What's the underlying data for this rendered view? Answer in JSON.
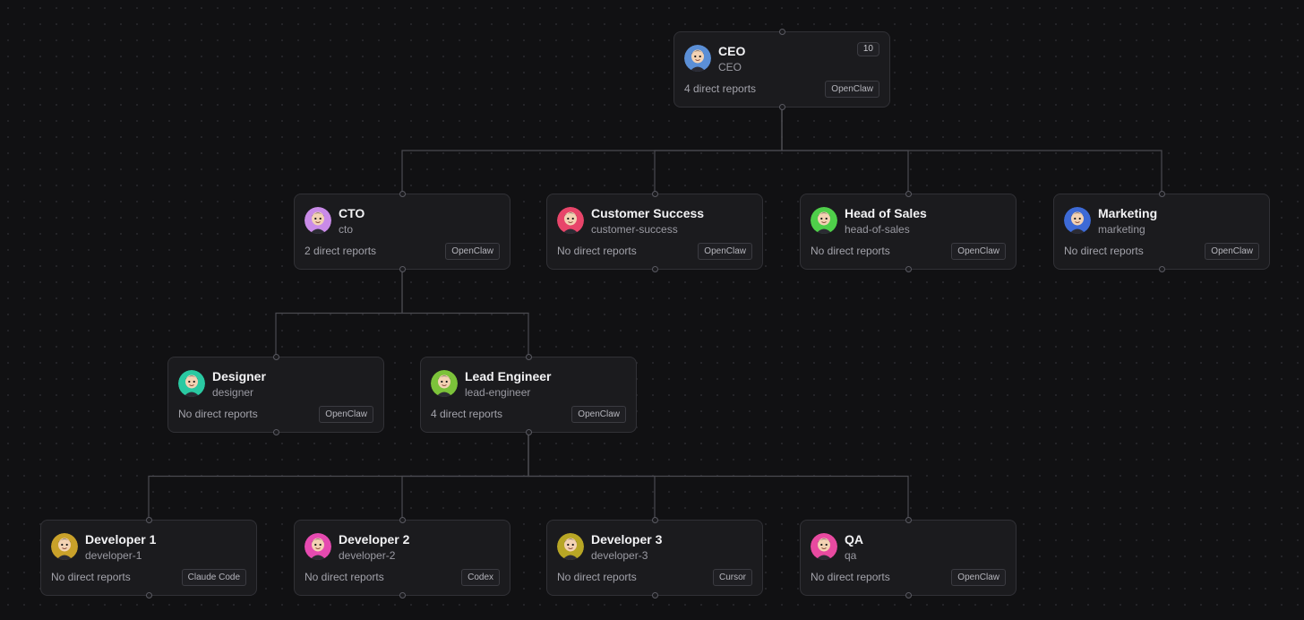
{
  "org_chart": {
    "nodes": [
      {
        "id": "ceo",
        "title": "CEO",
        "slug": "CEO",
        "reports": "4 direct reports",
        "tool": "OpenClaw",
        "count": "10",
        "avatar_color": "#5b8fd6",
        "parent": null
      },
      {
        "id": "cto",
        "title": "CTO",
        "slug": "cto",
        "reports": "2 direct reports",
        "tool": "OpenClaw",
        "avatar_color": "#c98be8",
        "parent": "ceo"
      },
      {
        "id": "customer-success",
        "title": "Customer Success",
        "slug": "customer-success",
        "reports": "No direct reports",
        "tool": "OpenClaw",
        "avatar_color": "#e8456a",
        "parent": "ceo"
      },
      {
        "id": "head-of-sales",
        "title": "Head of Sales",
        "slug": "head-of-sales",
        "reports": "No direct reports",
        "tool": "OpenClaw",
        "avatar_color": "#4fcf4a",
        "parent": "ceo"
      },
      {
        "id": "marketing",
        "title": "Marketing",
        "slug": "marketing",
        "reports": "No direct reports",
        "tool": "OpenClaw",
        "avatar_color": "#3d6ad6",
        "parent": "ceo"
      },
      {
        "id": "designer",
        "title": "Designer",
        "slug": "designer",
        "reports": "No direct reports",
        "tool": "OpenClaw",
        "avatar_color": "#2ac9a2",
        "parent": "cto"
      },
      {
        "id": "lead-engineer",
        "title": "Lead Engineer",
        "slug": "lead-engineer",
        "reports": "4 direct reports",
        "tool": "OpenClaw",
        "avatar_color": "#7cc23a",
        "parent": "cto"
      },
      {
        "id": "developer-1",
        "title": "Developer 1",
        "slug": "developer-1",
        "reports": "No direct reports",
        "tool": "Claude Code",
        "avatar_color": "#c9a12a",
        "parent": "lead-engineer"
      },
      {
        "id": "developer-2",
        "title": "Developer 2",
        "slug": "developer-2",
        "reports": "No direct reports",
        "tool": "Codex",
        "avatar_color": "#e64ab0",
        "parent": "lead-engineer"
      },
      {
        "id": "developer-3",
        "title": "Developer 3",
        "slug": "developer-3",
        "reports": "No direct reports",
        "tool": "Cursor",
        "avatar_color": "#b8a625",
        "parent": "lead-engineer"
      },
      {
        "id": "qa",
        "title": "QA",
        "slug": "qa",
        "reports": "No direct reports",
        "tool": "OpenClaw",
        "avatar_color": "#e84aa0",
        "parent": "lead-engineer"
      }
    ]
  }
}
